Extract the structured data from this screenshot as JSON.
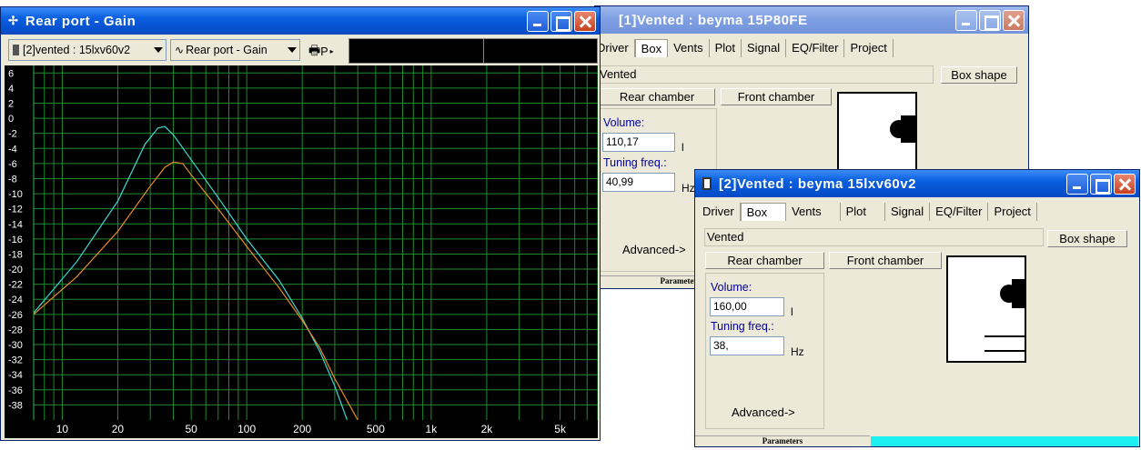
{
  "gain_window": {
    "title": "Rear port - Gain",
    "combo1": "[2]vented : 15lxv60v2",
    "combo2": "Rear port - Gain",
    "print_label": "P",
    "y_ticks": [
      "6",
      "4",
      "2",
      "0",
      "-2",
      "-4",
      "-6",
      "-8",
      "-10",
      "-12",
      "-14",
      "-16",
      "-18",
      "-20",
      "-22",
      "-24",
      "-26",
      "-28",
      "-30",
      "-32",
      "-34",
      "-36",
      "-38"
    ],
    "x_ticks": [
      "10",
      "20",
      "50",
      "100",
      "200",
      "500",
      "1k",
      "2k",
      "5k"
    ]
  },
  "chart_data": {
    "type": "line",
    "title": "Rear port - Gain",
    "x_scale": "log",
    "xlim": [
      7,
      8000
    ],
    "ylim": [
      -40,
      7
    ],
    "grid": true,
    "series": [
      {
        "color": "#41d8d3",
        "x": [
          7,
          12,
          20,
          28,
          33,
          36,
          40,
          50,
          70,
          100,
          150,
          200,
          250,
          300,
          350
        ],
        "y": [
          -25.8,
          -19,
          -11,
          -3.5,
          -1.3,
          -1.1,
          -2.2,
          -5.5,
          -10.5,
          -16,
          -21.5,
          -26.5,
          -31,
          -35.5,
          -40
        ]
      },
      {
        "color": "#e88c2a",
        "x": [
          7,
          12,
          20,
          30,
          36,
          40,
          45,
          50,
          70,
          100,
          150,
          200,
          250,
          300,
          400
        ],
        "y": [
          -26,
          -21,
          -15,
          -9,
          -6.5,
          -5.8,
          -6,
          -7.5,
          -12,
          -17,
          -22.5,
          -26.8,
          -30.5,
          -34.5,
          -40
        ]
      }
    ]
  },
  "win1": {
    "title": "[1]Vented : beyma  15P80FE",
    "tabs": [
      "Driver",
      "Box",
      "Vents",
      "Plot",
      "Signal",
      "EQ/Filter",
      "Project"
    ],
    "box_type": "Vented",
    "box_shape": "Box shape",
    "rear": "Rear chamber",
    "front": "Front chamber",
    "volume_label": "Volume:",
    "volume": "110,17",
    "volume_unit": "l",
    "tuning_label": "Tuning freq.:",
    "tuning": "40,99",
    "tuning_unit": "Hz",
    "advanced": "Advanced->",
    "status": "Parameters"
  },
  "win2": {
    "title": "[2]Vented : beyma 15lxv60v2",
    "tabs": [
      "Driver",
      "Box",
      "Vents",
      "Plot",
      "Signal",
      "EQ/Filter",
      "Project"
    ],
    "box_type": "Vented",
    "box_shape": "Box shape",
    "rear": "Rear chamber",
    "front": "Front chamber",
    "volume_label": "Volume:",
    "volume": "160,00",
    "volume_unit": "l",
    "tuning_label": "Tuning freq.:",
    "tuning": "38,",
    "tuning_unit": "Hz",
    "advanced": "Advanced->",
    "status": "Parameters"
  }
}
